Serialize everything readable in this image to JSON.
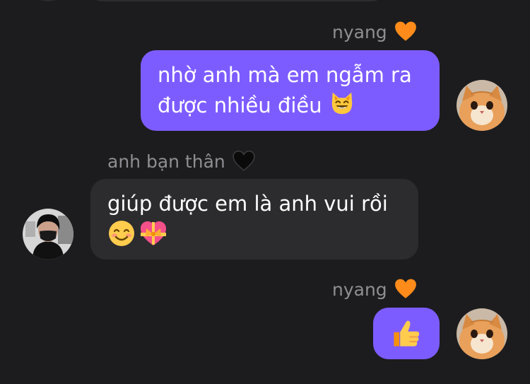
{
  "chat": {
    "messages": [
      {
        "sender": "nyang",
        "direction": "outgoing",
        "line1": "nhờ anh mà em ngẫm ra",
        "line2": "được nhiều điều",
        "emoji": "smiling-cat-emoji"
      },
      {
        "sender": "anh bạn thân",
        "direction": "incoming",
        "line1": "giúp được em là anh vui rồi",
        "emojis": [
          "smiling-face-emoji",
          "heart-with-ribbon-emoji"
        ]
      },
      {
        "sender": "nyang",
        "direction": "outgoing",
        "emoji": "thumbs-up-emoji"
      }
    ]
  },
  "colors": {
    "background": "#1c1c1e",
    "outgoing_bubble": "#7d5cff",
    "incoming_bubble": "#2c2c2e",
    "sender_name": "#8e8e93",
    "nyang_heart": "#ff8c1a",
    "friend_heart": "#0a0a0a"
  },
  "icons": {
    "nyang_badge": "orange-heart-icon",
    "friend_badge": "black-heart-icon",
    "nyang_avatar": "cat-avatar",
    "friend_avatar": "masked-person-avatar"
  }
}
